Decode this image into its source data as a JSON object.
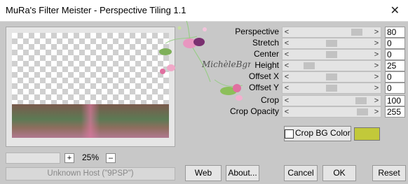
{
  "window": {
    "title": "MuRa's Filter Meister - Perspective Tiling 1.1"
  },
  "watermark": {
    "text": "MichèleBgraphisme"
  },
  "zoom": {
    "plus": "+",
    "value": "25%",
    "minus": "–"
  },
  "status": {
    "text": "Unknown Host (\"9PSP\")"
  },
  "params": [
    {
      "label": "Perspective",
      "value": "80"
    },
    {
      "label": "Stretch",
      "value": "0"
    },
    {
      "label": "Center",
      "value": "0"
    },
    {
      "label": "Height",
      "value": "25"
    },
    {
      "label": "Offset X",
      "value": "0"
    },
    {
      "label": "Offset Y",
      "value": "0"
    },
    {
      "label": "Crop",
      "value": "100"
    },
    {
      "label": "Crop Opacity",
      "value": "255"
    }
  ],
  "crop": {
    "label": "Crop BG Color",
    "checked": false,
    "color": "#c2c93a"
  },
  "buttons": {
    "web": "Web",
    "about": "About...",
    "cancel": "Cancel",
    "ok": "OK",
    "reset": "Reset"
  },
  "colors": {
    "accent": "#c2c93a",
    "background": "#c8c8c8"
  },
  "icons": {
    "close": "close-icon",
    "left": "arrow-left-icon",
    "right": "arrow-right-icon"
  }
}
